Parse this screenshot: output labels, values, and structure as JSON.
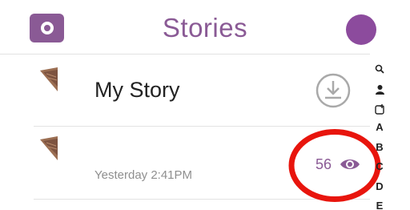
{
  "header": {
    "title": "Stories"
  },
  "stories": [
    {
      "name": "My Story"
    },
    {
      "timestamp": "Yesterday 2:41PM",
      "views": "56"
    }
  ],
  "index_bar": {
    "letters": [
      "A",
      "B",
      "C",
      "D",
      "E"
    ]
  },
  "colors": {
    "brand_purple": "#8a5a95",
    "avatar_purple": "#8c4b9d",
    "annotation_red": "#e8150d"
  },
  "icons": [
    "camera-icon",
    "download-icon",
    "eye-icon",
    "search-icon",
    "person-icon",
    "add-friend-icon"
  ]
}
